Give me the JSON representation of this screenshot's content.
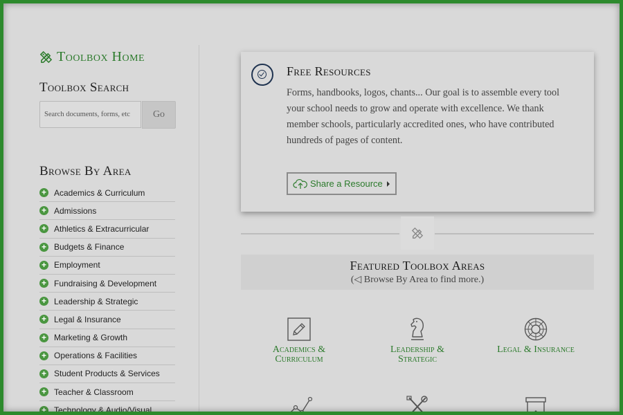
{
  "sidebar": {
    "home_label": "Toolbox Home",
    "search_title": "Toolbox Search",
    "search_placeholder": "Search documents, forms, etc",
    "go_label": "Go",
    "browse_title": "Browse By Area",
    "areas": [
      "Academics & Curriculum",
      "Admissions",
      "Athletics & Extracurricular",
      "Budgets & Finance",
      "Employment",
      "Fundraising & Development",
      "Leadership & Strategic",
      "Legal & Insurance",
      "Marketing & Growth",
      "Operations & Facilities",
      "Student Products & Services",
      "Teacher & Classroom",
      "Technology & Audio/Visual"
    ]
  },
  "card": {
    "title": "Free Resources",
    "text": "Forms, handbooks, logos, chants... Our goal is to assemble every tool your school needs to grow and operate with excellence. We thank member schools, particularly accredited ones, who have contributed hundreds of pages of content.",
    "share_label": "Share a Resource"
  },
  "featured": {
    "title": "Featured Toolbox Areas",
    "subtitle": "(◁ Browse By Area to find more.)",
    "tiles": [
      {
        "label_line1": "Academics &",
        "label_line2": "Curriculum",
        "icon": "pencil-square-icon"
      },
      {
        "label_line1": "Leadership &",
        "label_line2": "Strategic",
        "icon": "chess-knight-icon"
      },
      {
        "label_line1": "Legal & Insurance",
        "label_line2": "",
        "icon": "life-ring-icon"
      },
      {
        "label_line1": "",
        "label_line2": "",
        "icon": "line-chart-icon"
      },
      {
        "label_line1": "",
        "label_line2": "",
        "icon": "tools-icon"
      },
      {
        "label_line1": "",
        "label_line2": "",
        "icon": "trash-bin-icon"
      }
    ]
  },
  "colors": {
    "frame": "#2d8a2d",
    "accent_green": "#2b7a2b",
    "plus_green": "#4a9640",
    "background": "#d9d9d9",
    "navy": "#1f3350"
  }
}
